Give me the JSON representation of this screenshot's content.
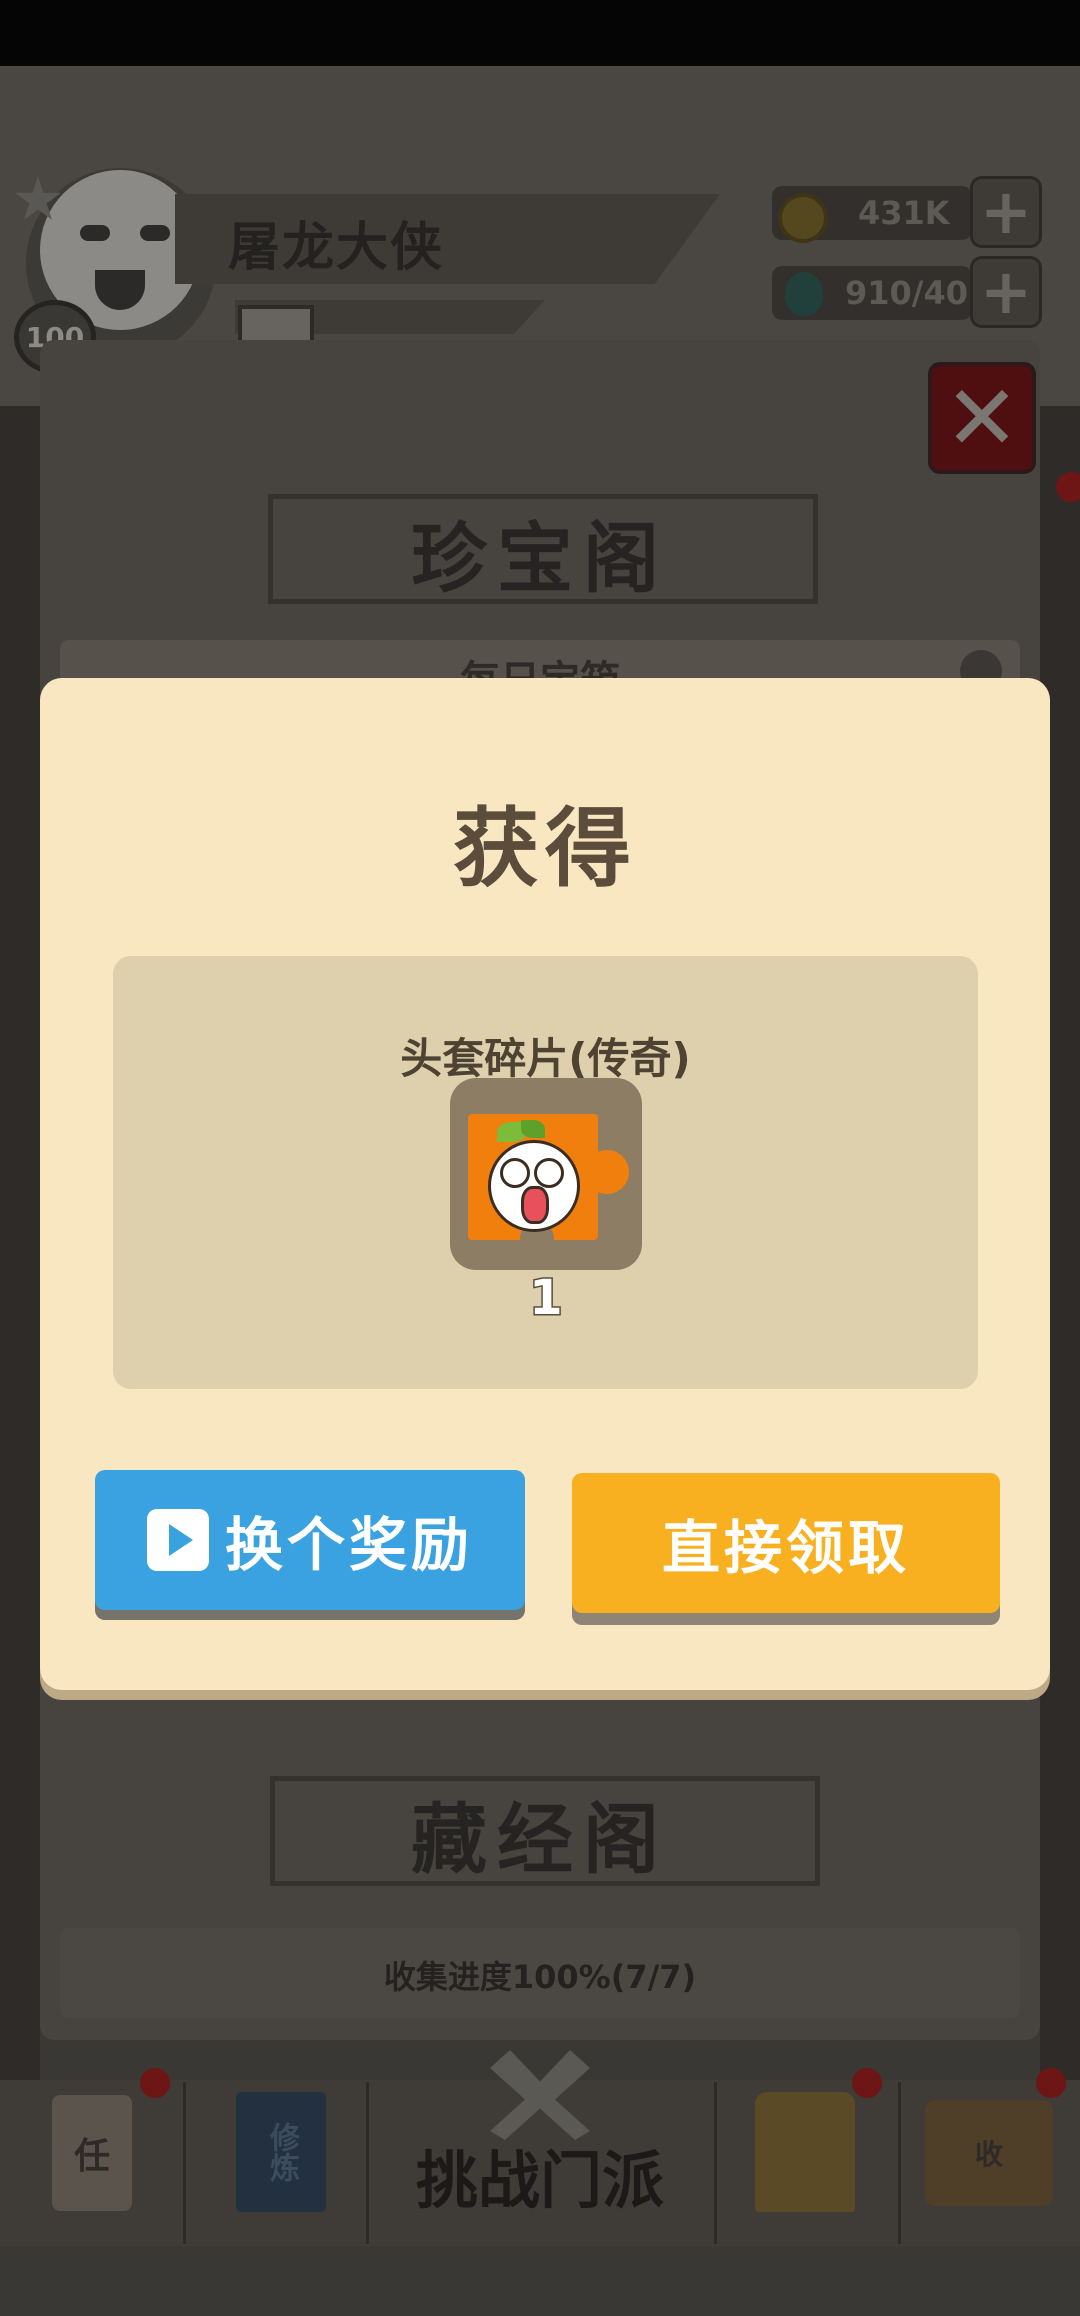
{
  "player": {
    "name": "屠龙大侠",
    "level": "100",
    "gold": "431K",
    "gems": "910/40"
  },
  "background": {
    "treasure_title": "珍宝阁",
    "daily_chest_label": "每日宝箱",
    "library_title": "藏经阁",
    "collection_progress": "收集进度100%(7/7)"
  },
  "bottom_nav": {
    "task_label": "任",
    "cultivate_label": "修炼",
    "challenge_label": "挑战门派",
    "collect_label": "收"
  },
  "dialog": {
    "title": "获得",
    "item_name": "头套碎片(传奇)",
    "item_icon": "orange-mascot-puzzle-icon",
    "item_count": "1",
    "change_button": "换个奖励",
    "claim_button": "直接领取"
  },
  "colors": {
    "dialog_bg": "#f8e7c1",
    "change_button": "#3aa2e0",
    "claim_button": "#f9b020",
    "piece_orange": "#f17f0d"
  }
}
